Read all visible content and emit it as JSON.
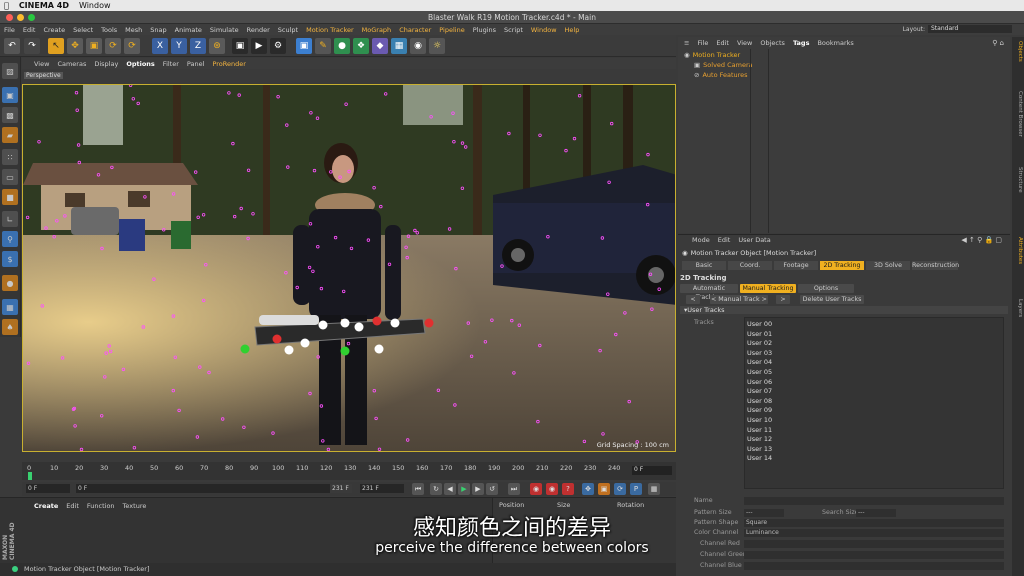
{
  "mac_menubar": {
    "app": "CINEMA 4D",
    "items": [
      "Window"
    ]
  },
  "window": {
    "title": "Blaster Walk R19 Motion Tracker.c4d * - Main"
  },
  "menubar": {
    "items": [
      "File",
      "Edit",
      "Create",
      "Select",
      "Tools",
      "Mesh",
      "Snap",
      "Animate",
      "Simulate",
      "Render",
      "Sculpt",
      "Motion Tracker",
      "MoGraph",
      "Character",
      "Pipeline",
      "Plugins",
      "Script",
      "Window",
      "Help"
    ],
    "layout_label": "Layout:",
    "layout_value": "Standard"
  },
  "viewport": {
    "menu": [
      "View",
      "Cameras",
      "Display",
      "Options",
      "Filter",
      "Panel",
      "ProRender"
    ],
    "name": "Perspective",
    "grid_spacing": "Grid Spacing : 100 cm"
  },
  "timeline": {
    "ticks": [
      "0",
      "10",
      "20",
      "30",
      "40",
      "50",
      "60",
      "70",
      "80",
      "90",
      "100",
      "110",
      "120",
      "130",
      "140",
      "150",
      "160",
      "170",
      "180",
      "190",
      "200",
      "210",
      "220",
      "230",
      "240"
    ],
    "current_frame": "0 F"
  },
  "transport": {
    "start": "0 F",
    "min": "0 F",
    "max": "231 F",
    "end": "231 F"
  },
  "material_manager": {
    "menu": [
      "Create",
      "Edit",
      "Function",
      "Texture"
    ]
  },
  "coordinates": {
    "headers": [
      "Position",
      "Size",
      "Rotation"
    ]
  },
  "status": {
    "text": "Motion Tracker Object [Motion Tracker]"
  },
  "object_manager": {
    "menu": [
      "File",
      "Edit",
      "View",
      "Objects",
      "Tags",
      "Bookmarks"
    ],
    "objects": [
      "Motion Tracker",
      "Solved Camera",
      "Auto Features"
    ]
  },
  "attribute_manager": {
    "menu": [
      "Mode",
      "Edit",
      "User Data"
    ],
    "object_title": "Motion Tracker Object [Motion Tracker]",
    "tabs": [
      "Basic",
      "Coord.",
      "Footage",
      "2D Tracking",
      "3D Solve",
      "Reconstruction"
    ],
    "section": "2D Tracking",
    "subtabs": [
      "Automatic Tracking",
      "Manual Tracking",
      "Options"
    ],
    "buttons": [
      "<",
      "< Manual Track >",
      ">",
      "Delete User Tracks"
    ],
    "group": "User Tracks",
    "tracks_label": "Tracks",
    "tracks": [
      "User 00",
      "User 01",
      "User 02",
      "User 03",
      "User 04",
      "User 05",
      "User 06",
      "User 07",
      "User 08",
      "User 09",
      "User 10",
      "User 11",
      "User 12",
      "User 13",
      "User 14"
    ],
    "params": {
      "name": "Name",
      "pattern_size": "Pattern Size",
      "pattern_size_value": "---",
      "search_size": "Search Size",
      "search_size_value": "---",
      "pattern_shape": "Pattern Shape",
      "pattern_shape_value": "Square",
      "color_channel": "Color Channel",
      "color_channel_value": "Luminance",
      "channel_red": "Channel Red",
      "channel_green": "Channel Green",
      "channel_blue": "Channel Blue"
    }
  },
  "side_tabs": [
    "Objects",
    "Content Browser",
    "Structure",
    "Attributes",
    "Layers"
  ],
  "subtitles": {
    "zh": "感知颜色之间的差异",
    "en": "perceive the difference between colors"
  },
  "colors": {
    "accent": "#f0b020",
    "track_point": "#ff50ff"
  }
}
